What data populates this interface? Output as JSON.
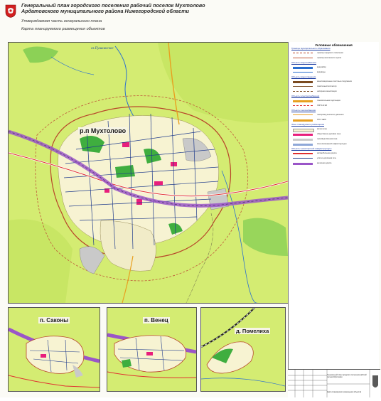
{
  "header": {
    "title_line1": "Генеральный план городского поселения рабочий поселок Мухтолово",
    "title_line2": "Ардатовского муниципального района Нижегородской области",
    "approved_part": "Утверждаемая часть генерального плана",
    "map_name": "Карта планируемого размещения объектов"
  },
  "map_labels": {
    "main_settlement": "р.п Мухтолово",
    "river": "оз.Пушкинское",
    "inset1": "п. Саконы",
    "inset2": "п. Венец",
    "inset3": "д. Помелиха"
  },
  "legend": {
    "title": "Условные обозначения",
    "sections": [
      {
        "header": "Границы муниципального образования",
        "items": [
          "граница городского поселения",
          "граница населенного пункта"
        ]
      },
      {
        "header": "Объекты водоснабжения",
        "items": [
          "водозабор",
          "водоводы"
        ]
      },
      {
        "header": "Объекты водоотведения",
        "items": [
          "канализационные очистные сооружения",
          "самотечный коллектор",
          "напорная канализация"
        ]
      },
      {
        "header": "Объекты электроснабжения",
        "items": [
          "понизительная подстанция",
          "ЛЭП 110 кВ"
        ]
      },
      {
        "header": "Объекты газоснабжения",
        "items": [
          "газопровод высокого давления",
          "ГРП / ШРП"
        ]
      },
      {
        "header": "Зоны планируемого размещения",
        "items": [
          "жилая зона",
          "общественно-деловая зона",
          "производственная зона",
          "зона инженерной инфраструктуры"
        ]
      },
      {
        "header": "Объекты транспортной инфраструктуры",
        "items": [
          "автомобильная дорога",
          "улично-дорожная сеть",
          "железная дорога"
        ]
      }
    ]
  },
  "stamp": {
    "description": "Генеральный план городского поселения рабочий поселок Мухтолово",
    "sheet": "Карта планируемого размещения объектов"
  },
  "colors": {
    "map_background": "#d4ec72",
    "residential": "#f7f3d2",
    "industrial": "#c9c9c9",
    "public": "#e81e7c",
    "forest": "#3fae3f",
    "railway": "#9a55c8",
    "roads": "#1f3b8c",
    "boundary": "#b8462a"
  }
}
